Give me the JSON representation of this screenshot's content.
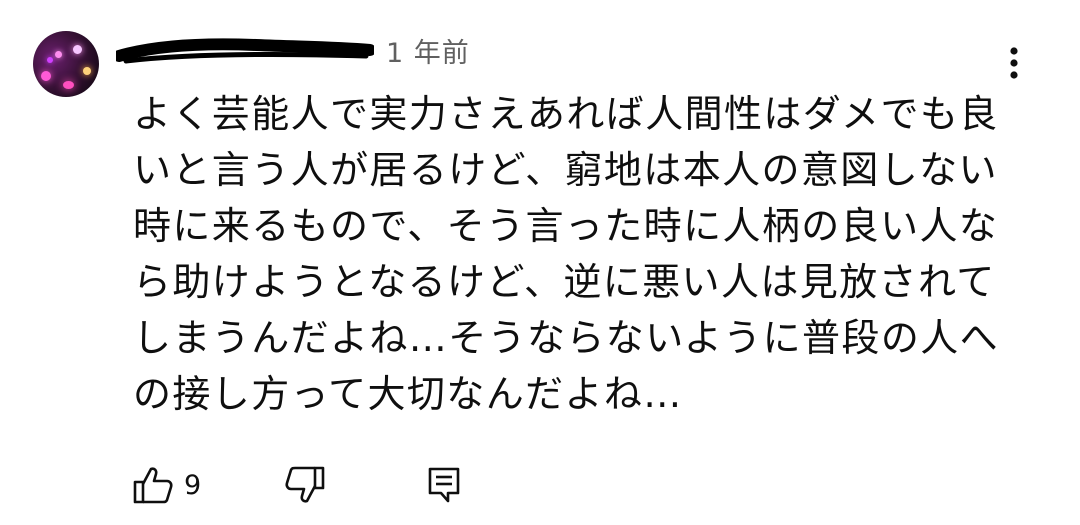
{
  "comment": {
    "author": "",
    "timestamp": "1 年前",
    "text": "よく芸能人で実力さえあれば人間性はダメでも良\nいと言う人が居るけど、窮地は本人の意図しない\n時に来るもので、そう言った時に人柄の良い人な\nら助けようとなるけど、逆に悪い人は見放されて\nしまうんだよね…そうならないように普段の人へ\nの接し方って大切なんだよね…",
    "like_count": "9"
  },
  "icons": {
    "like": "thumbs-up-icon",
    "dislike": "thumbs-down-icon",
    "reply": "reply-comment-icon",
    "more": "vertical-ellipsis-icon"
  },
  "colors": {
    "text": "#0f0f0f",
    "secondary_text": "#606060",
    "redaction": "#000000"
  }
}
